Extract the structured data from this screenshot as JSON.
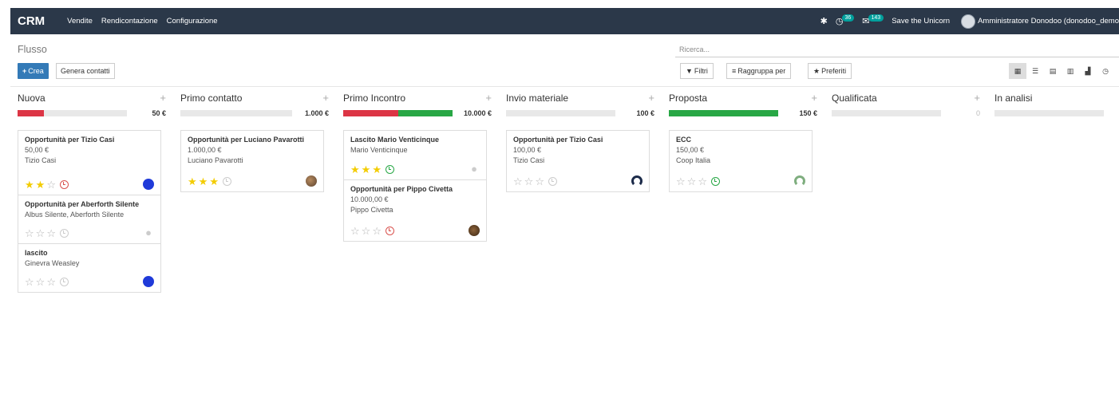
{
  "topbar": {
    "app_name": "CRM",
    "menu": [
      "Vendite",
      "Rendicontazione",
      "Configurazione"
    ],
    "activity_count": "36",
    "message_count": "143",
    "save_unicorn": "Save the Unicorn",
    "user": "Amministratore Donodoo (donodoo_demo"
  },
  "control_panel": {
    "breadcrumb": "Flusso",
    "create_label": "Crea",
    "generate_label": "Genera contatti",
    "search_placeholder": "Ricerca...",
    "filters_label": "Filtri",
    "group_by_label": "Raggruppa per",
    "favorites_label": "Preferiti"
  },
  "colors": {
    "red": "#dc3545",
    "green": "#28a745",
    "empty": "#e8e8e8",
    "navbar": "#2b3849",
    "primary": "#337ab7"
  },
  "columns": [
    {
      "title": "Nuova",
      "total": "50 €",
      "progress": {
        "red": 0.24,
        "green": 0,
        "empty": 0.76
      },
      "cards": [
        {
          "title": "Opportunità per Tizio Casi",
          "amount": "50,00 €",
          "contact": "Tizio Casi",
          "stars": 2,
          "activity": "red-clock-icon",
          "avatar": "blue-avatar-icon"
        },
        {
          "title": "Opportunità per Aberforth Silente",
          "amount": "",
          "contact": "Albus Silente, Aberforth Silente",
          "stars": 0,
          "activity": "grey-clock-icon",
          "avatar": "placeholder-avatar-icon"
        },
        {
          "title": "lascito",
          "amount": "",
          "contact": "Ginevra Weasley",
          "stars": 0,
          "activity": "grey-clock-icon",
          "avatar": "blue-avatar-icon"
        }
      ]
    },
    {
      "title": "Primo contatto",
      "total": "1.000 €",
      "progress": {
        "red": 0,
        "green": 0,
        "empty": 1
      },
      "cards": [
        {
          "title": "Opportunità per Luciano Pavarotti",
          "amount": "1.000,00 €",
          "contact": "Luciano Pavarotti",
          "stars": 3,
          "activity": "grey-clock-icon",
          "avatar": "photo-avatar-icon"
        }
      ]
    },
    {
      "title": "Primo Incontro",
      "total": "10.000 €",
      "progress": {
        "red": 0.5,
        "green": 0.5,
        "empty": 0
      },
      "cards": [
        {
          "title": "Lascito Mario Venticinque",
          "amount": "",
          "contact": "Mario Venticinque",
          "stars": 3,
          "activity": "green-clock-icon",
          "avatar": "placeholder-avatar-icon"
        },
        {
          "title": "Opportunità per Pippo Civetta",
          "amount": "10.000,00 €",
          "contact": "Pippo Civetta",
          "stars": 0,
          "activity": "red-clock-icon",
          "avatar": "photo-avatar-icon"
        }
      ]
    },
    {
      "title": "Invio materiale",
      "total": "100 €",
      "progress": {
        "red": 0,
        "green": 0,
        "empty": 1
      },
      "cards": [
        {
          "title": "Opportunità per Tizio Casi",
          "amount": "100,00 €",
          "contact": "Tizio Casi",
          "stars": 0,
          "activity": "grey-clock-icon",
          "avatar": "navy-avatar-icon"
        }
      ]
    },
    {
      "title": "Proposta",
      "total": "150 €",
      "progress": {
        "red": 0,
        "green": 1,
        "empty": 0
      },
      "cards": [
        {
          "title": "ECC",
          "amount": "150,00 €",
          "contact": "Coop Italia",
          "stars": 0,
          "activity": "green-clock-icon",
          "avatar": "green-avatar-icon"
        }
      ]
    },
    {
      "title": "Qualificata",
      "total": "0",
      "progress": {
        "red": 0,
        "green": 0,
        "empty": 1
      },
      "cards": []
    },
    {
      "title": "In analisi",
      "total": "",
      "progress": {
        "red": 0,
        "green": 0,
        "empty": 1
      },
      "cards": []
    }
  ]
}
